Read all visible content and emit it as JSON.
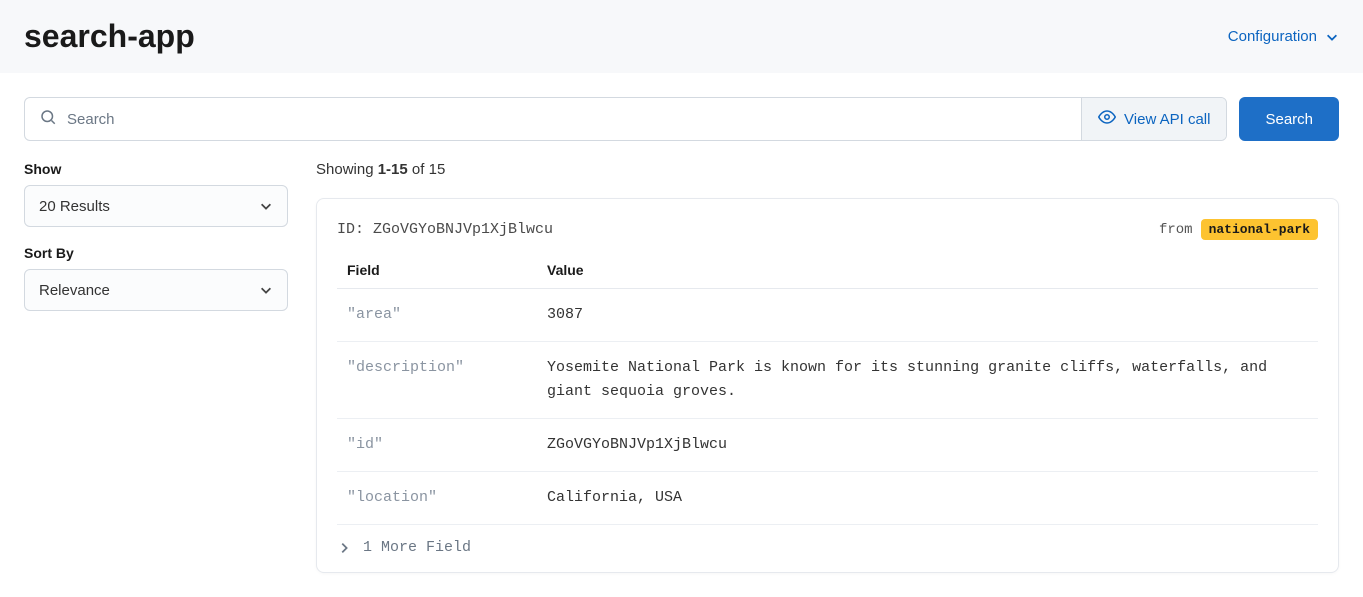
{
  "header": {
    "title": "search-app",
    "config_label": "Configuration"
  },
  "search": {
    "placeholder": "Search",
    "value": "",
    "view_api_label": "View API call",
    "search_button_label": "Search"
  },
  "sidebar": {
    "show_label": "Show",
    "show_value": "20 Results",
    "sort_label": "Sort By",
    "sort_value": "Relevance"
  },
  "results": {
    "summary_prefix": "Showing ",
    "summary_range": "1-15",
    "summary_middle": " of ",
    "summary_total": "15",
    "card": {
      "id_label": "ID: ",
      "id_value": "ZGoVGYoBNJVp1XjBlwcu",
      "from_label": "from",
      "from_badge": "national-park",
      "table": {
        "header_field": "Field",
        "header_value": "Value",
        "rows": [
          {
            "key": "\"area\"",
            "val": "3087"
          },
          {
            "key": "\"description\"",
            "val": "Yosemite National Park is known for its stunning granite cliffs, waterfalls, and giant sequoia groves."
          },
          {
            "key": "\"id\"",
            "val": "ZGoVGYoBNJVp1XjBlwcu"
          },
          {
            "key": "\"location\"",
            "val": "California, USA"
          }
        ]
      },
      "more_fields_label": "1 More Field"
    }
  }
}
